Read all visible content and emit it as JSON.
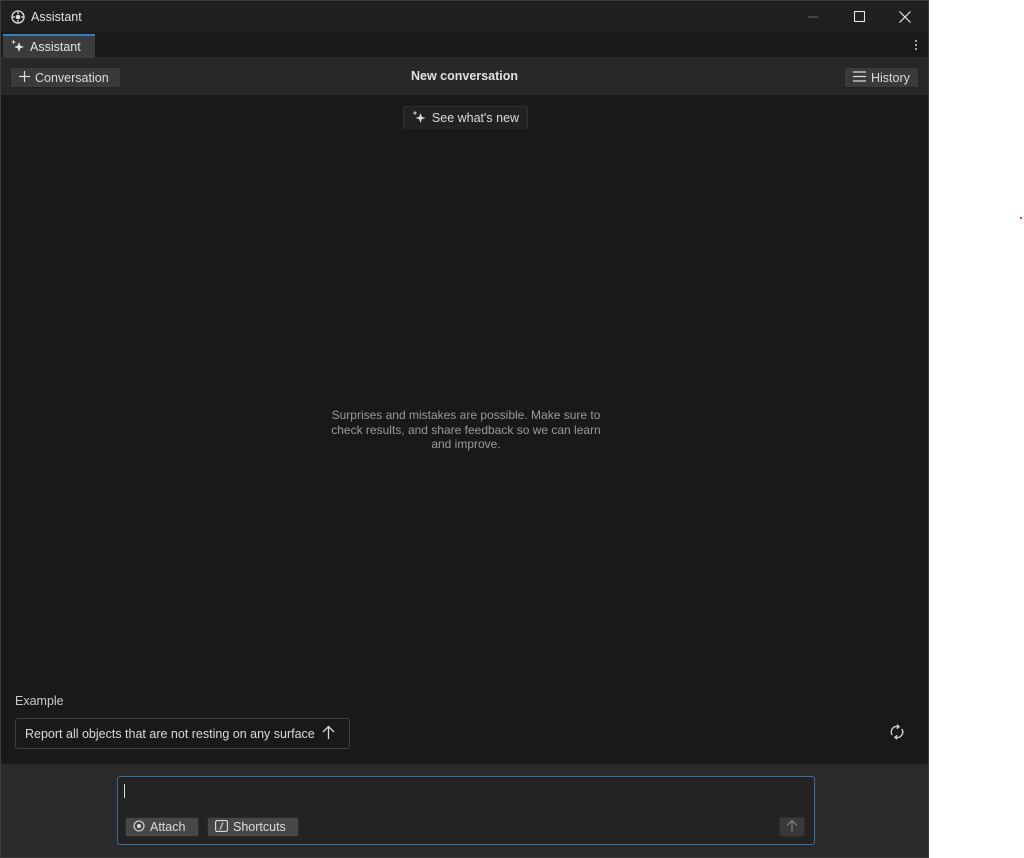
{
  "window": {
    "title": "Assistant",
    "controls": {
      "minimize": "minimize",
      "maximize": "maximize",
      "close": "close"
    }
  },
  "tabs": [
    {
      "label": "Assistant",
      "icon": "sparkle-icon",
      "active": true
    }
  ],
  "toolbar": {
    "new_conversation_label": "Conversation",
    "title": "New conversation",
    "history_label": "History"
  },
  "content": {
    "whats_new_label": "See what's new",
    "disclaimer": "Surprises and mistakes are possible. Make sure to check results, and share feedback so we can learn and improve.",
    "example_label": "Example",
    "example_prompt": "Report all objects that are not resting on any surface"
  },
  "input": {
    "value": "",
    "placeholder": "",
    "attach_label": "Attach",
    "shortcuts_label": "Shortcuts"
  },
  "colors": {
    "background": "#191919",
    "toolbar": "#282828",
    "accent_border": "#3b6ea0",
    "tab_accent": "#3a79bb"
  }
}
